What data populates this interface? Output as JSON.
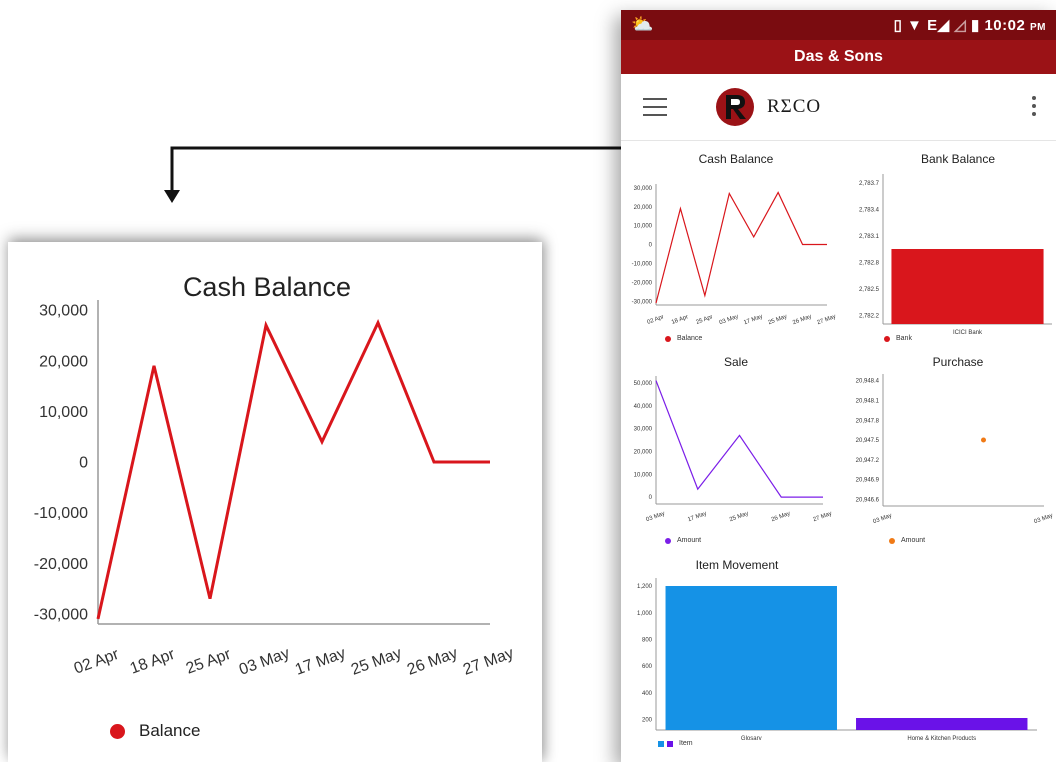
{
  "status_bar": {
    "time": "10:02",
    "ampm": "PM",
    "network": "E",
    "weather_icon": "sun-cloud-icon"
  },
  "title_bar": {
    "title": "Das & Sons"
  },
  "app_bar": {
    "logo_text": "RΣCO",
    "menu_icon": "hamburger-menu-icon",
    "overflow_icon": "more-vert-icon"
  },
  "colors": {
    "primary_dark": "#7a0c10",
    "primary": "#9b1216",
    "red_series": "#d9161c",
    "purple_series": "#7b1ee8",
    "orange_series": "#f07a16",
    "blue_series": "#1592e6"
  },
  "chart_data": [
    {
      "id": "cash_balance",
      "type": "line",
      "title": "Cash Balance",
      "categories": [
        "02 Apr",
        "18 Apr",
        "25 Apr",
        "03 May",
        "17 May",
        "25 May",
        "26 May",
        "27 May"
      ],
      "series": [
        {
          "name": "Balance",
          "values": [
            -31000,
            19000,
            -27000,
            27000,
            4000,
            27500,
            0,
            0
          ],
          "color": "#d9161c"
        }
      ],
      "y_ticks": [
        "30,000",
        "20,000",
        "10,000",
        "0",
        "-10,000",
        "-20,000",
        "-30,000"
      ],
      "ylim": [
        -32000,
        32000
      ]
    },
    {
      "id": "bank_balance",
      "type": "bar",
      "title": "Bank Balance",
      "categories": [
        "ICICI Bank"
      ],
      "series": [
        {
          "name": "Bank",
          "values": [
            2782.95
          ],
          "color": "#d9161c"
        }
      ],
      "y_ticks": [
        "2,783.7",
        "2,783.4",
        "2,783.1",
        "2,782.8",
        "2,782.5",
        "2,782.2"
      ],
      "ylim": [
        2782.1,
        2783.8
      ]
    },
    {
      "id": "sale",
      "type": "line",
      "title": "Sale",
      "categories": [
        "03 May",
        "17 May",
        "25 May",
        "26 May",
        "27 May"
      ],
      "series": [
        {
          "name": "Amount",
          "values": [
            51000,
            3500,
            27000,
            0,
            0
          ],
          "color": "#7b1ee8"
        }
      ],
      "y_ticks": [
        "50,000",
        "40,000",
        "30,000",
        "20,000",
        "10,000",
        "0"
      ],
      "ylim": [
        -3000,
        53000
      ]
    },
    {
      "id": "purchase",
      "type": "scatter",
      "title": "Purchase",
      "categories": [
        "03 May",
        "03 May"
      ],
      "series": [
        {
          "name": "Amount",
          "values": [
            20947.5
          ],
          "color": "#f07a16"
        }
      ],
      "y_ticks": [
        "20,948.4",
        "20,948.1",
        "20,947.8",
        "20,947.5",
        "20,947.2",
        "20,946.9",
        "20,946.6"
      ],
      "ylim": [
        20946.5,
        20948.5
      ]
    },
    {
      "id": "item_movement",
      "type": "bar",
      "title": "Item Movement",
      "categories": [
        "Glosary",
        "Home & Kitchen Products"
      ],
      "series": [
        {
          "name": "Item",
          "values": [
            1200,
            210
          ],
          "colors": [
            "#1592e6",
            "#6a12e8"
          ]
        }
      ],
      "y_ticks": [
        "1,200",
        "1,000",
        "800",
        "600",
        "400",
        "200"
      ],
      "ylim": [
        120,
        1260
      ]
    }
  ],
  "zoom": {
    "title": "Cash Balance",
    "legend": "Balance"
  }
}
